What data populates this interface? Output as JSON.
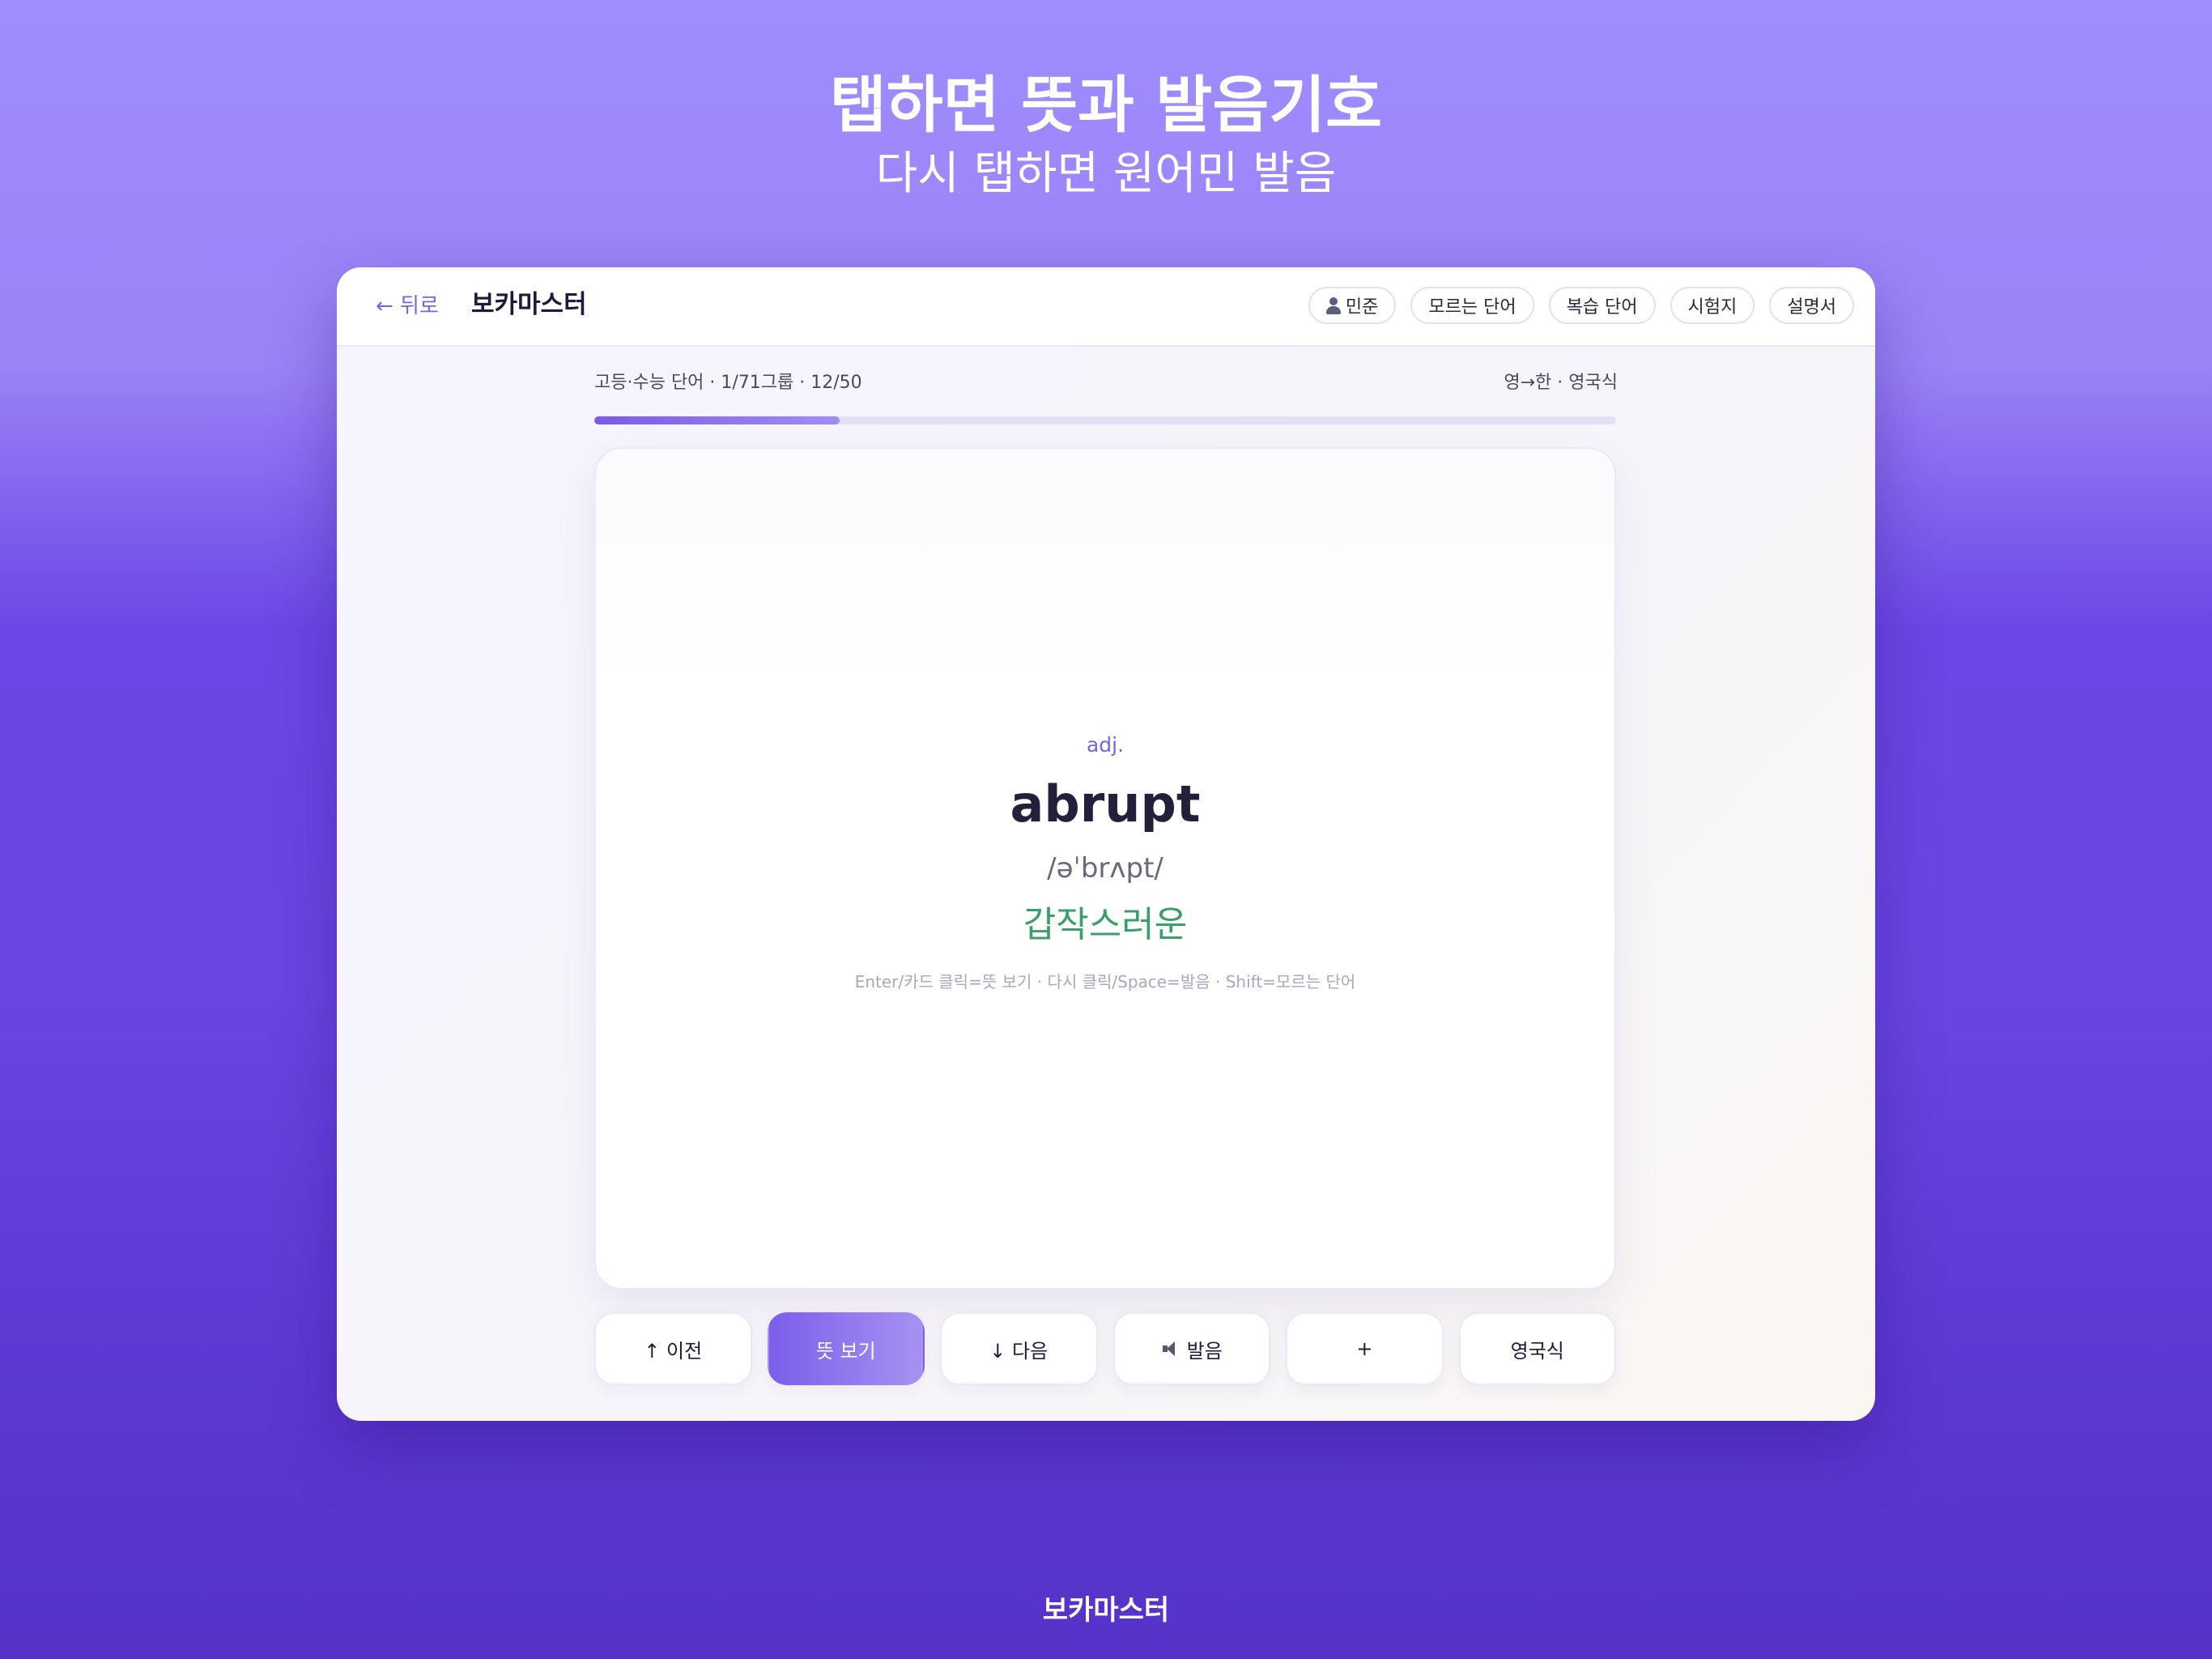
{
  "hero": {
    "title": "탭하면 뜻과 발음기호",
    "subtitle": "다시 탭하면 원어민 발음"
  },
  "top_bar": {
    "back_label": "← 뒤로",
    "app_title": "보카마스터",
    "user_name": "민준",
    "nav_items": [
      {
        "label": "모르는 단어"
      },
      {
        "label": "복습 단어"
      },
      {
        "label": "시험지"
      },
      {
        "label": "설명서"
      }
    ]
  },
  "session": {
    "meta_left": "고등·수능 단어 · 1/71그룹 · 12/50",
    "meta_right": "영→한 · 영국식",
    "progress_current": 12,
    "progress_total": 50,
    "progress_fraction": 0.24
  },
  "card": {
    "part_of_speech": "adj.",
    "word": "abrupt",
    "phonetic": "/əˈbrʌpt/",
    "meaning": "갑작스러운",
    "hint": "Enter/카드 클릭=뜻 보기 · 다시 클릭/Space=발음 · Shift=모르는 단어"
  },
  "actions": {
    "prev_label": "↑ 이전",
    "reveal_label": "뜻 보기",
    "next_label": "↓ 다음",
    "audio_label": "발음",
    "add_label": "+",
    "accent_label": "영국식"
  },
  "footer": {
    "brand": "보카마스터"
  },
  "icons": {
    "user": "user-icon",
    "speaker": "speaker-icon"
  },
  "colors": {
    "accent": "#7a64e6",
    "meaning_green": "#3b9f68",
    "primary_button_start": "#7b5eea",
    "primary_button_end": "#a792f2"
  }
}
